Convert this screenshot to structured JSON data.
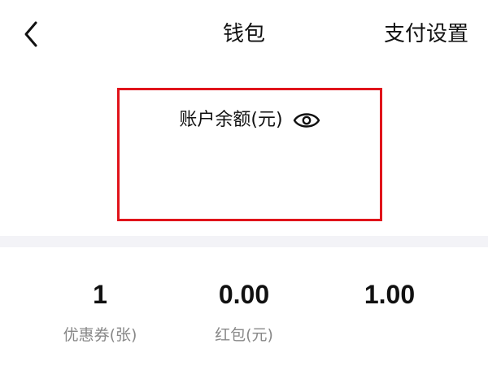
{
  "header": {
    "back_icon": "chevron-left-icon",
    "title": "钱包",
    "pay_settings_label": "支付设置"
  },
  "balance": {
    "label": "账户余额(元)",
    "visibility_icon": "eye-icon",
    "highlight_color": "#e0141b"
  },
  "stats": [
    {
      "value": "1",
      "label": "优惠券(张)"
    },
    {
      "value": "0.00",
      "label": "红包(元)"
    },
    {
      "value": "1.00",
      "label": ""
    }
  ]
}
